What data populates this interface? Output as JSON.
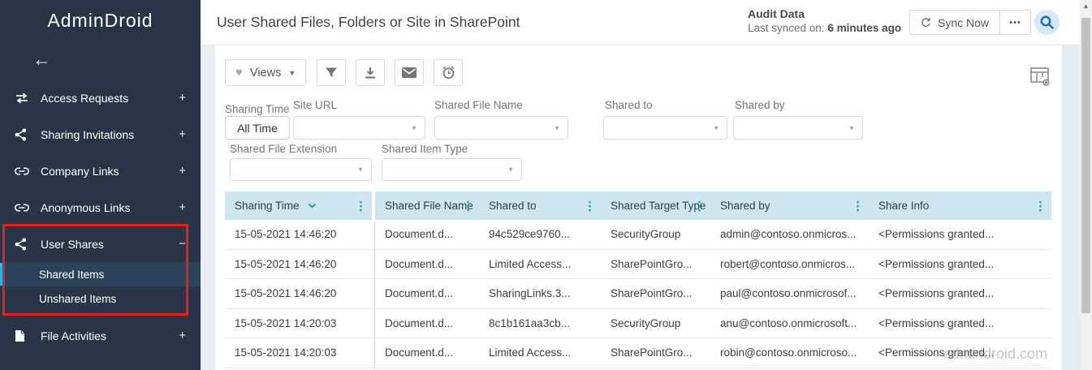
{
  "sidebar": {
    "logo": "AdminDroid",
    "items": [
      {
        "label": "Access Requests",
        "expander": "+"
      },
      {
        "label": "Sharing Invitations",
        "expander": "+"
      },
      {
        "label": "Company Links",
        "expander": "+"
      },
      {
        "label": "Anonymous Links",
        "expander": "+"
      },
      {
        "label": "User Shares",
        "expander": "−"
      },
      {
        "label": "File Activities",
        "expander": "+"
      }
    ],
    "user_shares_children": [
      {
        "label": "Shared Items"
      },
      {
        "label": "Unshared Items"
      }
    ]
  },
  "header": {
    "title": "User Shared Files, Folders or Site in SharePoint",
    "audit_title": "Audit Data",
    "last_synced_label": "Last synced on: ",
    "last_synced_value": "6 minutes ago",
    "sync_button_label": "Sync Now",
    "more_button_label": "•••"
  },
  "toolbar": {
    "views_label": "Views"
  },
  "filters": {
    "sharing_time": {
      "label": "Sharing Time",
      "value": "All Time"
    },
    "site_url": {
      "label": "Site URL",
      "value": ""
    },
    "shared_file_name": {
      "label": "Shared File Name",
      "value": ""
    },
    "shared_to": {
      "label": "Shared to",
      "value": ""
    },
    "shared_by": {
      "label": "Shared by",
      "value": ""
    },
    "shared_file_extension": {
      "label": "Shared File Extension",
      "value": ""
    },
    "shared_item_type": {
      "label": "Shared Item Type",
      "value": ""
    }
  },
  "table": {
    "columns": [
      "Sharing Time",
      "Shared File Name",
      "Shared to",
      "Shared Target Type",
      "Shared by",
      "Share Info"
    ],
    "sort": {
      "column": "Sharing Time",
      "direction": "desc"
    },
    "rows": [
      [
        "15-05-2021 14:46:20",
        "Document.d...",
        "94c529ce9760...",
        "SecurityGroup",
        "admin@contoso.onmicros...",
        "<Permissions granted..."
      ],
      [
        "15-05-2021 14:46:20",
        "Document.d...",
        "Limited Access...",
        "SharePointGro...",
        "robert@contoso.onmicros...",
        "<Permissions granted..."
      ],
      [
        "15-05-2021 14:46:20",
        "Document.d...",
        "SharingLinks.3...",
        "SharePointGro...",
        "paul@contoso.onmicrosof...",
        "<Permissions granted..."
      ],
      [
        "15-05-2021 14:20:03",
        "Document.d...",
        "8c1b161aa3cb...",
        "SecurityGroup",
        "anu@contoso.onmicrosoft...",
        "<Permissions granted..."
      ],
      [
        "15-05-2021 14:20:03",
        "Document.d...",
        "Limited Access...",
        "SharePointGro...",
        "robin@contoso.onmicroso...",
        "<Permissions granted..."
      ]
    ]
  },
  "watermark": "admindroid.com",
  "icons": {
    "back": "←",
    "heart": "♥",
    "dropdown_caret": "▼",
    "menu_dots": "⋮",
    "scroll_up_arrow": "▲"
  },
  "colors": {
    "sidebar_bg": "#2a3447",
    "accent_teal": "#0f9ba5",
    "table_header_bg": "#cee6ef",
    "annotation_red": "#e4201f",
    "selected_item_cyan": "#27b6e9",
    "search_blue": "#1a6fc0"
  }
}
